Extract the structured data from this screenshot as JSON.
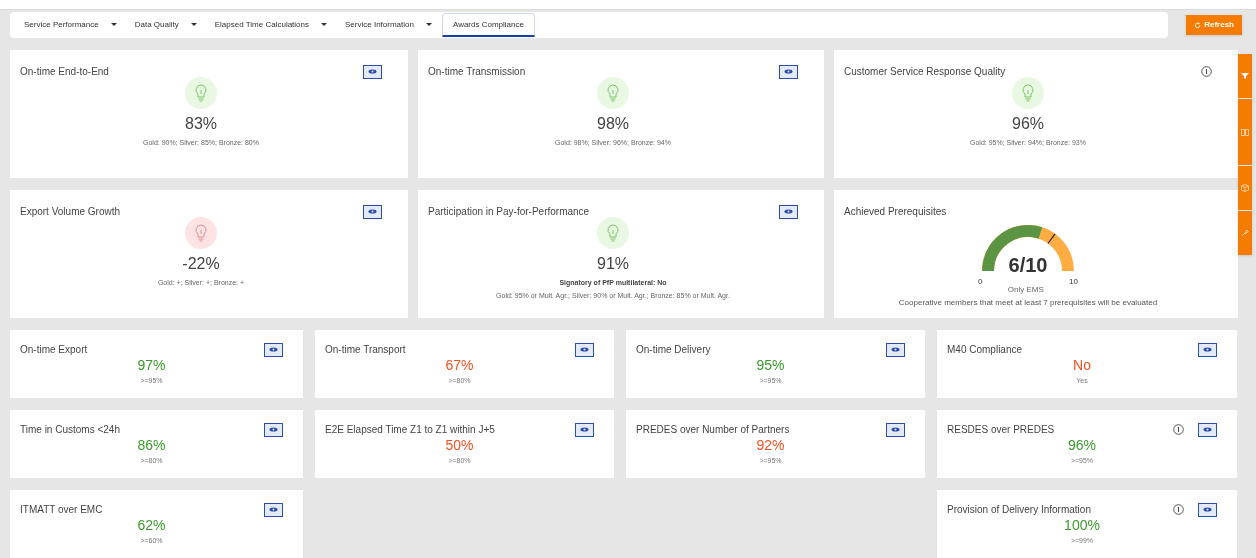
{
  "tabs": [
    {
      "label": "Service Performance",
      "dropdown": true,
      "selected": false
    },
    {
      "label": "Data Quality",
      "dropdown": true,
      "selected": false
    },
    {
      "label": "Elapsed Time Calculations",
      "dropdown": true,
      "selected": false
    },
    {
      "label": "Service Information",
      "dropdown": true,
      "selected": false
    },
    {
      "label": "Awards Compliance",
      "dropdown": false,
      "selected": true
    }
  ],
  "refresh_button": "Refresh",
  "award_cards": [
    {
      "kind": "award",
      "title": "On-time End-to-End",
      "met": true,
      "value": "83%",
      "thresholds": "Gold: 90%; Silver: 85%; Bronze: 80%",
      "eye": true,
      "info": false
    },
    {
      "kind": "award",
      "title": "On-time Transmission",
      "met": true,
      "value": "98%",
      "thresholds": "Gold: 98%; Silver: 96%; Bronze: 94%",
      "eye": true,
      "info": false
    },
    {
      "kind": "award",
      "title": "Customer Service Response Quality",
      "met": true,
      "value": "96%",
      "thresholds": "Gold: 95%; Silver: 94%; Bronze: 93%",
      "eye": false,
      "info": true
    },
    {
      "kind": "award",
      "title": "Export Volume Growth",
      "met": false,
      "value": "-22%",
      "thresholds": "Gold: +; Silver: +; Bronze: +",
      "eye": true,
      "info": false
    },
    {
      "kind": "award",
      "title": "Participation in Pay-for-Performance",
      "met": true,
      "value": "91%",
      "note": "Signatory of PfP multilateral: No",
      "thresholds": "Gold: 95% or Mult. Agr.; Silver: 90% or Mult. Agr.; Bronze: 85% or Mult. Agr.",
      "eye": true,
      "info": false
    },
    {
      "kind": "gauge",
      "title": "Achieved Prerequisites",
      "value": "6/10",
      "min": "0",
      "max": "10",
      "sublabel": "Only EMS",
      "footnote": "Cooperative members that meet at least 7 prerequisites will be evaluated"
    }
  ],
  "indicator_cards": [
    {
      "title": "On-time Export",
      "met": true,
      "value": "97%",
      "target": ">=95%",
      "eye": true,
      "info": false
    },
    {
      "title": "On-time Transport",
      "met": false,
      "value": "67%",
      "target": ">=80%",
      "eye": true,
      "info": false
    },
    {
      "title": "On-time Delivery",
      "met": true,
      "value": "95%",
      "target": ">=95%",
      "eye": true,
      "info": false
    },
    {
      "title": "M40 Compliance",
      "met": false,
      "value": "No",
      "target": "Yes",
      "eye": true,
      "info": false
    },
    {
      "title": "Time in Customs <24h",
      "met": true,
      "value": "86%",
      "target": ">=80%",
      "eye": true,
      "info": false
    },
    {
      "title": "E2E Elapsed Time Z1 to Z1 within J+5",
      "met": false,
      "value": "50%",
      "target": ">=80%",
      "eye": true,
      "info": false
    },
    {
      "title": "PREDES over Number of Partners",
      "met": false,
      "value": "92%",
      "target": ">=95%",
      "eye": true,
      "info": false
    },
    {
      "title": "RESDES over PREDES",
      "met": true,
      "value": "96%",
      "target": ">=95%",
      "eye": true,
      "info": true
    },
    {
      "title": "ITMATT over EMC",
      "met": true,
      "value": "62%",
      "target": ">=60%",
      "eye": true,
      "info": false
    },
    {
      "title": "Provision of Delivery Information",
      "met": true,
      "value": "100%",
      "target": ">=99%",
      "eye": true,
      "info": true
    }
  ]
}
